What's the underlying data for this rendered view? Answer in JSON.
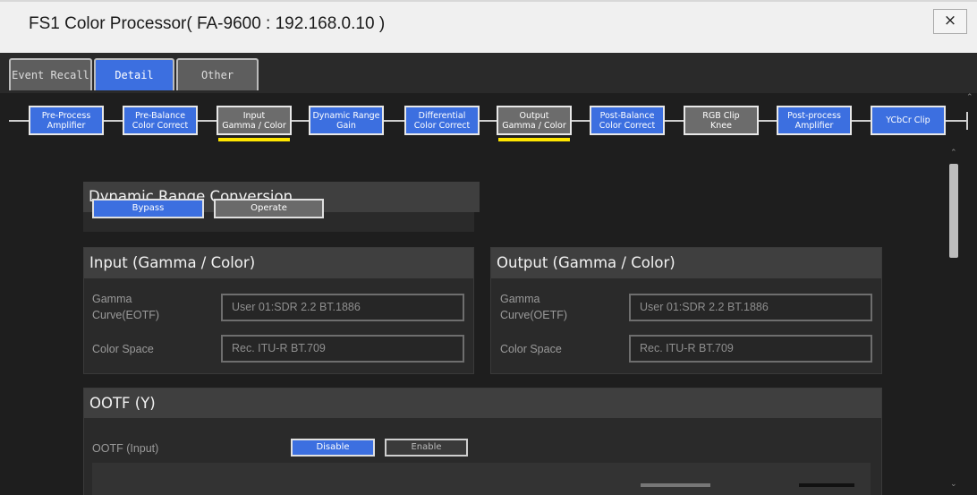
{
  "window": {
    "title": "FS1 Color Processor( FA-9600 : 192.168.0.10 )",
    "close_label": "×"
  },
  "tabs": [
    {
      "label": "Event Recall",
      "active": false
    },
    {
      "label": "Detail",
      "active": true
    },
    {
      "label": "Other",
      "active": false
    }
  ],
  "flow": [
    {
      "label": "Pre-Process\nAmplifier"
    },
    {
      "label": "Pre-Balance\nColor Correct"
    },
    {
      "label": "Input\nGamma / Color"
    },
    {
      "label": "Dynamic Range\nGain"
    },
    {
      "label": "Differential\nColor Correct"
    },
    {
      "label": "Output\nGamma / Color"
    },
    {
      "label": "Post-Balance\nColor Correct"
    },
    {
      "label": "RGB Clip\nKnee"
    },
    {
      "label": "Post-process\nAmplifier"
    },
    {
      "label": "YCbCr Clip"
    }
  ],
  "dynamic_range": {
    "title": "Dynamic Range Conversion",
    "bypass_label": "Bypass",
    "operate_label": "Operate",
    "selected": "Bypass"
  },
  "input_gamma": {
    "title": "Input (Gamma / Color)",
    "gamma_label": "Gamma\nCurve(EOTF)",
    "gamma_value": "User 01:SDR 2.2 BT.1886",
    "color_label": "Color Space",
    "color_value": "Rec. ITU-R BT.709"
  },
  "output_gamma": {
    "title": "Output (Gamma / Color)",
    "gamma_label": "Gamma\nCurve(OETF)",
    "gamma_value": "User 01:SDR 2.2 BT.1886",
    "color_label": "Color Space",
    "color_value": "Rec. ITU-R BT.709"
  },
  "ootf": {
    "title": "OOTF (Y)",
    "input_label": "OOTF (Input)",
    "disable_label": "Disable",
    "enable_label": "Enable",
    "selected": "Disable"
  },
  "colors": {
    "accent": "#3c6fe0",
    "highlight": "#ffe600",
    "panel": "#2a2a2a",
    "panel_head": "#3f3f3f"
  }
}
